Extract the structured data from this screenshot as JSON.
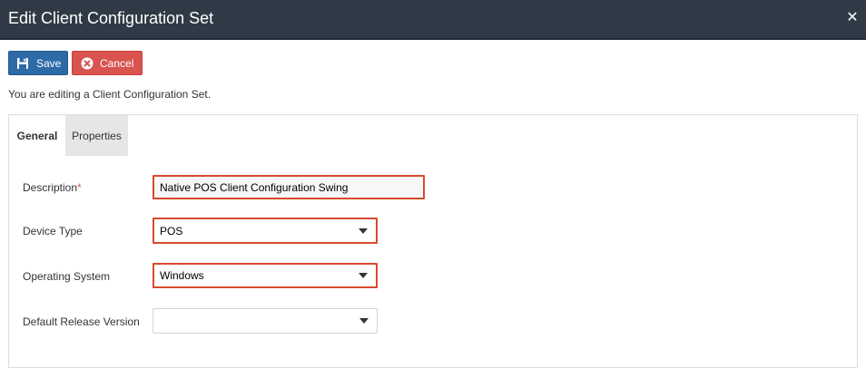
{
  "dialog": {
    "title": "Edit Client Configuration Set",
    "close_glyph": "✕"
  },
  "toolbar": {
    "save_label": "Save",
    "save_icon": "floppy-disk-icon",
    "cancel_label": "Cancel",
    "cancel_icon": "x-circle-icon"
  },
  "info_text": "You are editing a Client Configuration Set.",
  "tabs": [
    {
      "label": "General",
      "active": true
    },
    {
      "label": "Properties",
      "active": false
    }
  ],
  "form": {
    "description": {
      "label": "Description",
      "required_marker": "*",
      "value": "Native POS Client Configuration Swing"
    },
    "device_type": {
      "label": "Device Type",
      "value": "POS"
    },
    "operating_system": {
      "label": "Operating System",
      "value": "Windows"
    },
    "default_release_version": {
      "label": "Default Release Version",
      "value": ""
    }
  },
  "colors": {
    "header_bg": "#2f3a46",
    "save_bg": "#2d6aa6",
    "cancel_bg": "#d9534f",
    "highlight_border": "#d9492f"
  }
}
